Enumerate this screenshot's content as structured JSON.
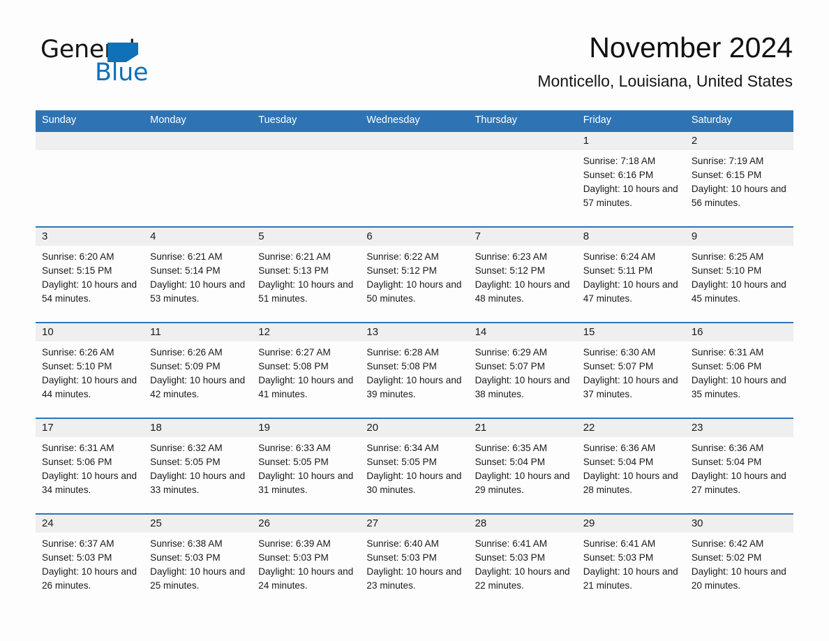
{
  "brand": {
    "name_part1": "General",
    "name_part2": "Blue",
    "accent_color": "#1070b8",
    "triangle_icon": "triangle-icon"
  },
  "header": {
    "title": "November 2024",
    "location": "Monticello, Louisiana, United States"
  },
  "calendar": {
    "header_color": "#2e74b5",
    "row_band_color": "#efefef",
    "day_names": [
      "Sunday",
      "Monday",
      "Tuesday",
      "Wednesday",
      "Thursday",
      "Friday",
      "Saturday"
    ],
    "weeks": [
      [
        {
          "day": "",
          "sunrise": "",
          "sunset": "",
          "daylight": "",
          "empty": true
        },
        {
          "day": "",
          "sunrise": "",
          "sunset": "",
          "daylight": "",
          "empty": true
        },
        {
          "day": "",
          "sunrise": "",
          "sunset": "",
          "daylight": "",
          "empty": true
        },
        {
          "day": "",
          "sunrise": "",
          "sunset": "",
          "daylight": "",
          "empty": true
        },
        {
          "day": "",
          "sunrise": "",
          "sunset": "",
          "daylight": "",
          "empty": true
        },
        {
          "day": "1",
          "sunrise": "Sunrise: 7:18 AM",
          "sunset": "Sunset: 6:16 PM",
          "daylight": "Daylight: 10 hours and 57 minutes.",
          "empty": false
        },
        {
          "day": "2",
          "sunrise": "Sunrise: 7:19 AM",
          "sunset": "Sunset: 6:15 PM",
          "daylight": "Daylight: 10 hours and 56 minutes.",
          "empty": false
        }
      ],
      [
        {
          "day": "3",
          "sunrise": "Sunrise: 6:20 AM",
          "sunset": "Sunset: 5:15 PM",
          "daylight": "Daylight: 10 hours and 54 minutes.",
          "empty": false
        },
        {
          "day": "4",
          "sunrise": "Sunrise: 6:21 AM",
          "sunset": "Sunset: 5:14 PM",
          "daylight": "Daylight: 10 hours and 53 minutes.",
          "empty": false
        },
        {
          "day": "5",
          "sunrise": "Sunrise: 6:21 AM",
          "sunset": "Sunset: 5:13 PM",
          "daylight": "Daylight: 10 hours and 51 minutes.",
          "empty": false
        },
        {
          "day": "6",
          "sunrise": "Sunrise: 6:22 AM",
          "sunset": "Sunset: 5:12 PM",
          "daylight": "Daylight: 10 hours and 50 minutes.",
          "empty": false
        },
        {
          "day": "7",
          "sunrise": "Sunrise: 6:23 AM",
          "sunset": "Sunset: 5:12 PM",
          "daylight": "Daylight: 10 hours and 48 minutes.",
          "empty": false
        },
        {
          "day": "8",
          "sunrise": "Sunrise: 6:24 AM",
          "sunset": "Sunset: 5:11 PM",
          "daylight": "Daylight: 10 hours and 47 minutes.",
          "empty": false
        },
        {
          "day": "9",
          "sunrise": "Sunrise: 6:25 AM",
          "sunset": "Sunset: 5:10 PM",
          "daylight": "Daylight: 10 hours and 45 minutes.",
          "empty": false
        }
      ],
      [
        {
          "day": "10",
          "sunrise": "Sunrise: 6:26 AM",
          "sunset": "Sunset: 5:10 PM",
          "daylight": "Daylight: 10 hours and 44 minutes.",
          "empty": false
        },
        {
          "day": "11",
          "sunrise": "Sunrise: 6:26 AM",
          "sunset": "Sunset: 5:09 PM",
          "daylight": "Daylight: 10 hours and 42 minutes.",
          "empty": false
        },
        {
          "day": "12",
          "sunrise": "Sunrise: 6:27 AM",
          "sunset": "Sunset: 5:08 PM",
          "daylight": "Daylight: 10 hours and 41 minutes.",
          "empty": false
        },
        {
          "day": "13",
          "sunrise": "Sunrise: 6:28 AM",
          "sunset": "Sunset: 5:08 PM",
          "daylight": "Daylight: 10 hours and 39 minutes.",
          "empty": false
        },
        {
          "day": "14",
          "sunrise": "Sunrise: 6:29 AM",
          "sunset": "Sunset: 5:07 PM",
          "daylight": "Daylight: 10 hours and 38 minutes.",
          "empty": false
        },
        {
          "day": "15",
          "sunrise": "Sunrise: 6:30 AM",
          "sunset": "Sunset: 5:07 PM",
          "daylight": "Daylight: 10 hours and 37 minutes.",
          "empty": false
        },
        {
          "day": "16",
          "sunrise": "Sunrise: 6:31 AM",
          "sunset": "Sunset: 5:06 PM",
          "daylight": "Daylight: 10 hours and 35 minutes.",
          "empty": false
        }
      ],
      [
        {
          "day": "17",
          "sunrise": "Sunrise: 6:31 AM",
          "sunset": "Sunset: 5:06 PM",
          "daylight": "Daylight: 10 hours and 34 minutes.",
          "empty": false
        },
        {
          "day": "18",
          "sunrise": "Sunrise: 6:32 AM",
          "sunset": "Sunset: 5:05 PM",
          "daylight": "Daylight: 10 hours and 33 minutes.",
          "empty": false
        },
        {
          "day": "19",
          "sunrise": "Sunrise: 6:33 AM",
          "sunset": "Sunset: 5:05 PM",
          "daylight": "Daylight: 10 hours and 31 minutes.",
          "empty": false
        },
        {
          "day": "20",
          "sunrise": "Sunrise: 6:34 AM",
          "sunset": "Sunset: 5:05 PM",
          "daylight": "Daylight: 10 hours and 30 minutes.",
          "empty": false
        },
        {
          "day": "21",
          "sunrise": "Sunrise: 6:35 AM",
          "sunset": "Sunset: 5:04 PM",
          "daylight": "Daylight: 10 hours and 29 minutes.",
          "empty": false
        },
        {
          "day": "22",
          "sunrise": "Sunrise: 6:36 AM",
          "sunset": "Sunset: 5:04 PM",
          "daylight": "Daylight: 10 hours and 28 minutes.",
          "empty": false
        },
        {
          "day": "23",
          "sunrise": "Sunrise: 6:36 AM",
          "sunset": "Sunset: 5:04 PM",
          "daylight": "Daylight: 10 hours and 27 minutes.",
          "empty": false
        }
      ],
      [
        {
          "day": "24",
          "sunrise": "Sunrise: 6:37 AM",
          "sunset": "Sunset: 5:03 PM",
          "daylight": "Daylight: 10 hours and 26 minutes.",
          "empty": false
        },
        {
          "day": "25",
          "sunrise": "Sunrise: 6:38 AM",
          "sunset": "Sunset: 5:03 PM",
          "daylight": "Daylight: 10 hours and 25 minutes.",
          "empty": false
        },
        {
          "day": "26",
          "sunrise": "Sunrise: 6:39 AM",
          "sunset": "Sunset: 5:03 PM",
          "daylight": "Daylight: 10 hours and 24 minutes.",
          "empty": false
        },
        {
          "day": "27",
          "sunrise": "Sunrise: 6:40 AM",
          "sunset": "Sunset: 5:03 PM",
          "daylight": "Daylight: 10 hours and 23 minutes.",
          "empty": false
        },
        {
          "day": "28",
          "sunrise": "Sunrise: 6:41 AM",
          "sunset": "Sunset: 5:03 PM",
          "daylight": "Daylight: 10 hours and 22 minutes.",
          "empty": false
        },
        {
          "day": "29",
          "sunrise": "Sunrise: 6:41 AM",
          "sunset": "Sunset: 5:03 PM",
          "daylight": "Daylight: 10 hours and 21 minutes.",
          "empty": false
        },
        {
          "day": "30",
          "sunrise": "Sunrise: 6:42 AM",
          "sunset": "Sunset: 5:02 PM",
          "daylight": "Daylight: 10 hours and 20 minutes.",
          "empty": false
        }
      ]
    ]
  }
}
